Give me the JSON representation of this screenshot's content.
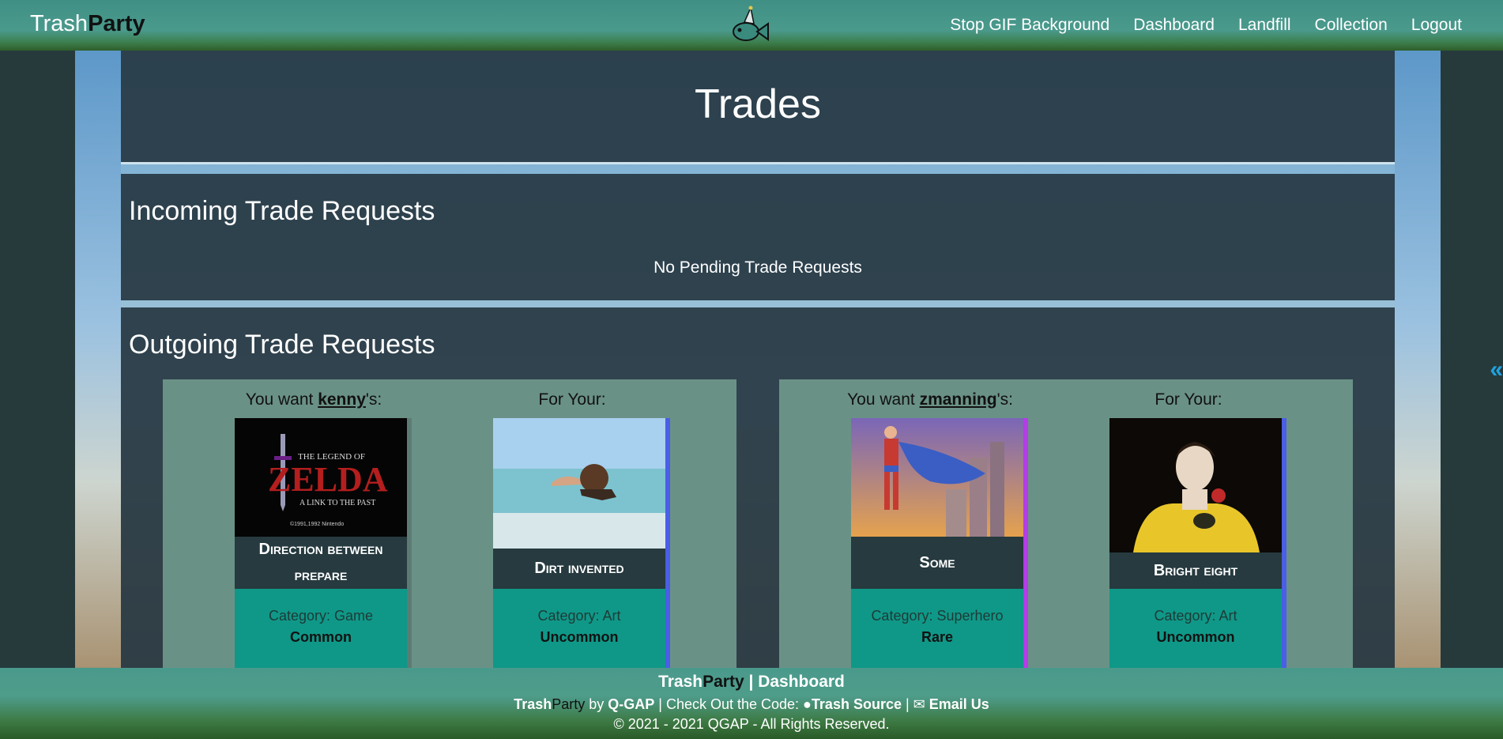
{
  "nav": {
    "brand_part1": "Trash",
    "brand_part2": "Party",
    "links": [
      "Stop GIF Background",
      "Dashboard",
      "Landfill",
      "Collection",
      "Logout"
    ]
  },
  "page_title": "Trades",
  "incoming": {
    "heading": "Incoming Trade Requests",
    "empty_text": "No Pending Trade Requests"
  },
  "outgoing": {
    "heading": "Outgoing Trade Requests",
    "trades": [
      {
        "want_prefix": "You want ",
        "user": "kenny",
        "want_suffix": "'s:",
        "for_label": "For Your:",
        "their_card": {
          "name": "Direction between prepare",
          "category": "Category: Game",
          "rarity": "Common"
        },
        "your_card": {
          "name": "Dirt invented",
          "category": "Category: Art",
          "rarity": "Uncommon"
        }
      },
      {
        "want_prefix": "You want ",
        "user": "zmanning",
        "want_suffix": "'s:",
        "for_label": "For Your:",
        "their_card": {
          "name": "Some",
          "category": "Category: Superhero",
          "rarity": "Rare"
        },
        "your_card": {
          "name": "Bright eight",
          "category": "Category: Art",
          "rarity": "Uncommon"
        }
      }
    ]
  },
  "footer": {
    "line1_brand1": "Trash",
    "line1_brand2": "Party",
    "line1_sep": " | ",
    "line1_link": "Dashboard",
    "line2_brand1": "Trash",
    "line2_brand2": "Party",
    "line2_by": " by ",
    "line2_team": "Q-GAP",
    "line2_mid": " | Check Out the Code: ",
    "line2_source": "Trash Source",
    "line2_sep": " | ",
    "line2_email": "Email Us",
    "copyright": "© 2021 - 2021 QGAP - All Rights Reserved."
  },
  "colors": {
    "nav": "#4a9a8c",
    "card_info": "#0f9888",
    "card_name": "#263a3f",
    "rare_edge": "#b33de6",
    "uncommon_edge": "#4a5ee6"
  },
  "side_toggle": "«"
}
